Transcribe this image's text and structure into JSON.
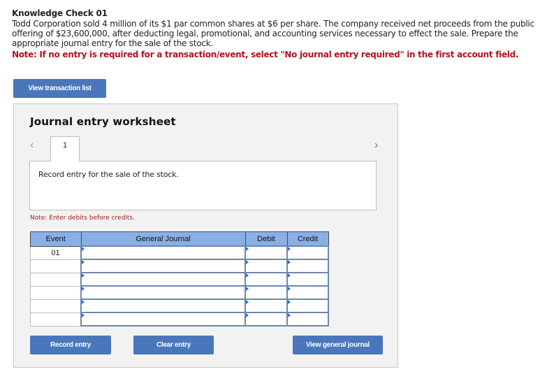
{
  "question": {
    "title": "Knowledge Check 01",
    "body": "Todd Corporation sold 4 million of its $1 par common shares at $6 per share. The company received net proceeds from the public offering of $23,600,000, after deducting legal, promotional, and accounting services necessary to effect the sale. Prepare the appropriate journal entry for the sale of the stock.",
    "note": "Note: If no entry is required for a transaction/event, select \"No journal entry required\" in the first account field."
  },
  "buttons": {
    "view_transaction_list": "View transaction list",
    "record_entry": "Record entry",
    "clear_entry": "Clear entry",
    "view_general_journal": "View general journal"
  },
  "worksheet": {
    "title": "Journal entry worksheet",
    "prev_icon": "‹",
    "next_icon": "›",
    "active_tab": "1",
    "description": "Record entry for the sale of the stock.",
    "debit_note": "Note: Enter debits before credits."
  },
  "journal_table": {
    "headers": [
      "Event",
      "General Journal",
      "Debit",
      "Credit"
    ],
    "rows": [
      {
        "event": "01",
        "account": "",
        "debit": "",
        "credit": ""
      },
      {
        "event": "",
        "account": "",
        "debit": "",
        "credit": ""
      },
      {
        "event": "",
        "account": "",
        "debit": "",
        "credit": ""
      },
      {
        "event": "",
        "account": "",
        "debit": "",
        "credit": ""
      },
      {
        "event": "",
        "account": "",
        "debit": "",
        "credit": ""
      },
      {
        "event": "",
        "account": "",
        "debit": "",
        "credit": ""
      }
    ]
  },
  "colors": {
    "button": "#4a76bb",
    "header": "#8aafe5",
    "note_red": "#b5121b"
  }
}
